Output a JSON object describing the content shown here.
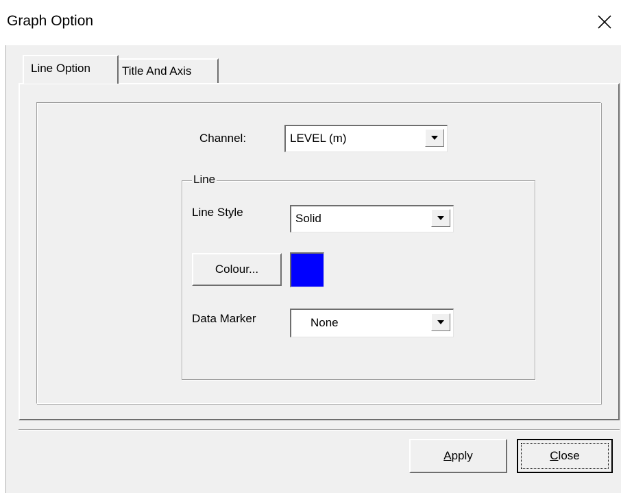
{
  "window": {
    "title": "Graph Option"
  },
  "tabs": [
    {
      "label": "Line Option",
      "active": true
    },
    {
      "label": "Title And Axis",
      "active": false
    }
  ],
  "channel": {
    "label": "Channel:",
    "value": "LEVEL (m)"
  },
  "line_group": {
    "legend": "Line",
    "line_style_label": "Line Style",
    "line_style_value": "Solid",
    "colour_button": "Colour...",
    "colour_value": "#0000ff",
    "data_marker_label": "Data Marker",
    "data_marker_value": "None"
  },
  "footer": {
    "apply_label": "Apply",
    "close_label": "Close"
  },
  "icons": {
    "close": "close-icon",
    "dropdown": "chevron-down-icon"
  }
}
